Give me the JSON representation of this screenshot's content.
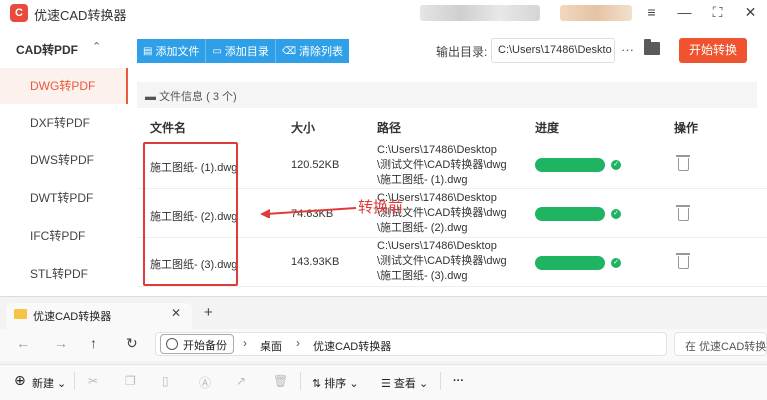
{
  "app": {
    "logo_text": "C",
    "title": "优速CAD转换器",
    "window_controls": {
      "menu": "≡",
      "minimize": "—",
      "maximize": "⛶",
      "close": "✕"
    }
  },
  "sidebar": {
    "header": "CAD转PDF",
    "chevron": "⌃",
    "items": [
      {
        "label": "DWG转PDF",
        "active": true
      },
      {
        "label": "DXF转PDF",
        "active": false
      },
      {
        "label": "DWS转PDF",
        "active": false
      },
      {
        "label": "DWT转PDF",
        "active": false
      },
      {
        "label": "IFC转PDF",
        "active": false
      },
      {
        "label": "STL转PDF",
        "active": false
      }
    ]
  },
  "toolbar": {
    "add_file": "添加文件",
    "add_dir": "添加目录",
    "clear_list": "清除列表",
    "output_label": "输出目录:",
    "output_path": "C:\\Users\\17486\\Deskto",
    "more": "···",
    "start": "开始转换"
  },
  "table": {
    "info_label": "文件信息",
    "info_count": "( 3 个)",
    "headers": {
      "name": "文件名",
      "size": "大小",
      "path": "路径",
      "progress": "进度",
      "action": "操作"
    },
    "rows": [
      {
        "name": "施工图纸- (1).dwg",
        "size": "120.52KB",
        "path": [
          "C:\\Users\\17486\\Desktop",
          "\\测试文件\\CAD转换器\\dwg",
          "\\施工图纸- (1).dwg"
        ],
        "progress": 1.0
      },
      {
        "name": "施工图纸- (2).dwg",
        "size": "74.63KB",
        "path": [
          "C:\\Users\\17486\\Desktop",
          "\\测试文件\\CAD转换器\\dwg",
          "\\施工图纸- (2).dwg"
        ],
        "progress": 1.0
      },
      {
        "name": "施工图纸- (3).dwg",
        "size": "143.93KB",
        "path": [
          "C:\\Users\\17486\\Desktop",
          "\\测试文件\\CAD转换器\\dwg",
          "\\施工图纸- (3).dwg"
        ],
        "progress": 1.0
      }
    ]
  },
  "annotation": {
    "label": "转换前",
    "color": "#e03b3b"
  },
  "explorer": {
    "tab_title": "优速CAD转换器",
    "tab_close": "✕",
    "new_tab": "+",
    "nav": {
      "back": "←",
      "forward": "→",
      "up": "↑",
      "refresh": "↻"
    },
    "backup_label": "开始备份",
    "breadcrumb": [
      "桌面",
      "优速CAD转换器"
    ],
    "crumb_sep": "›",
    "search_placeholder": "在 优速CAD转换器",
    "cmd": {
      "new": "新建",
      "sort": "排序",
      "view": "查看",
      "more": "···"
    }
  },
  "colors": {
    "accent": "#f0532f",
    "toolbar_blue": "#2fa0e8",
    "progress_green": "#1fb462"
  }
}
